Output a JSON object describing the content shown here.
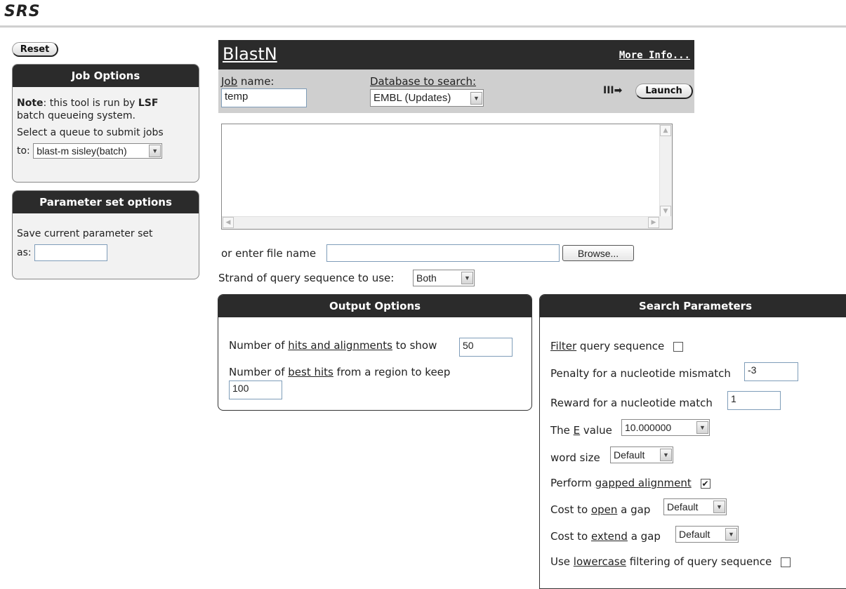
{
  "app": {
    "logo": "SRS"
  },
  "reset_label": "Reset",
  "job_options": {
    "title": "Job Options",
    "note_label": "Note",
    "note_text_1": ": this tool is run by ",
    "note_bold": "LSF",
    "note_text_2": "batch queueing system.",
    "select_text": "Select a queue to submit jobs",
    "to_label": "to:",
    "queue_value": "blast-m sisley(batch)"
  },
  "param_set": {
    "title": "Parameter set options",
    "save_text": "Save current parameter set",
    "as_label": "as:",
    "as_value": ""
  },
  "blastn": {
    "title": "BlastN",
    "more_info": "More Info...",
    "job_name_label_link": "Job",
    "job_name_label_rest": " name:",
    "job_name_value": "temp",
    "database_label": "Database to search:",
    "database_value": "EMBL (Updates)",
    "launch_label": "Launch",
    "launch_arrow": "III➡"
  },
  "sequence": {
    "value": "",
    "file_label": "or enter file name",
    "file_value": "",
    "browse_label": "Browse...",
    "strand_label": "Strand of query sequence to use:",
    "strand_value": "Both"
  },
  "output_options": {
    "title": "Output Options",
    "hits_pre": "Number of ",
    "hits_link": "hits and alignments",
    "hits_post": " to show",
    "hits_value": "50",
    "best_pre": "Number of ",
    "best_link": "best hits",
    "best_post": " from a region to keep",
    "best_value": "100"
  },
  "search_parameters": {
    "title": "Search Parameters",
    "filter_link": "Filter",
    "filter_rest": " query sequence",
    "filter_checked": false,
    "mismatch_label": "Penalty for a nucleotide mismatch",
    "mismatch_value": "-3",
    "reward_label": "Reward for a nucleotide match",
    "reward_value": "1",
    "evalue_pre": "The ",
    "evalue_link": "E",
    "evalue_post": " value",
    "evalue_value": "10.000000",
    "word_size_label": "word size",
    "word_size_value": "Default",
    "gapped_pre": "Perform ",
    "gapped_link": "gapped alignment",
    "gapped_checked": true,
    "open_pre": "Cost to ",
    "open_link": "open",
    "open_post": " a gap",
    "open_value": "Default",
    "extend_pre": "Cost to ",
    "extend_link": "extend",
    "extend_post": " a gap",
    "extend_value": "Default",
    "lower_pre": "Use ",
    "lower_link": "lowercase",
    "lower_post": " filtering of query sequence",
    "lower_checked": false
  },
  "icons": {
    "dropdown": "chevron-down-icon",
    "check": "✔",
    "arrow_up": "▲",
    "arrow_down": "▼",
    "arrow_left": "◀",
    "arrow_right": "▶"
  }
}
